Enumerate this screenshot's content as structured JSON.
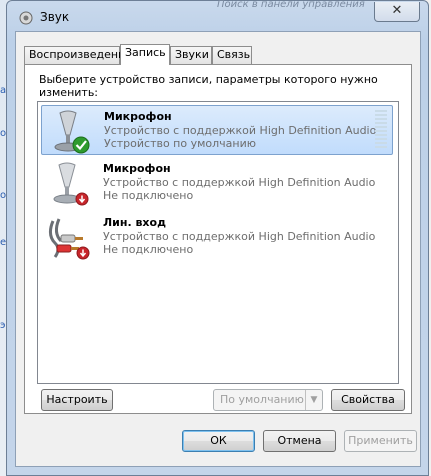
{
  "window": {
    "title": "Звук",
    "background_text": "Поиск в панели управления"
  },
  "tabs": [
    {
      "label": "Воспроизведение",
      "active": false
    },
    {
      "label": "Запись",
      "active": true
    },
    {
      "label": "Звуки",
      "active": false
    },
    {
      "label": "Связь",
      "active": false
    }
  ],
  "recording": {
    "prompt": "Выберите устройство записи, параметры которого нужно изменить:",
    "devices": [
      {
        "name": "Микрофон",
        "description": "Устройство с поддержкой High Definition Audio",
        "status": "Устройство по умолчанию",
        "icon": "microphone-icon",
        "badge": "default-checkmark-icon",
        "selected": true
      },
      {
        "name": "Микрофон",
        "description": "Устройство с поддержкой High Definition Audio",
        "status": "Не подключено",
        "icon": "microphone-icon",
        "badge": "unplugged-arrow-icon",
        "selected": false
      },
      {
        "name": "Лин. вход",
        "description": "Устройство с поддержкой High Definition Audio",
        "status": "Не подключено",
        "icon": "line-in-cable-icon",
        "badge": "unplugged-arrow-icon",
        "selected": false
      }
    ]
  },
  "buttons": {
    "configure": "Настроить",
    "set_default": "По умолчанию",
    "properties": "Свойства",
    "ok": "ОК",
    "cancel": "Отмена",
    "apply": "Применить"
  },
  "colors": {
    "selection": "#c1dcfc",
    "badge_green": "#2e9b2e",
    "badge_red": "#c8262b"
  }
}
